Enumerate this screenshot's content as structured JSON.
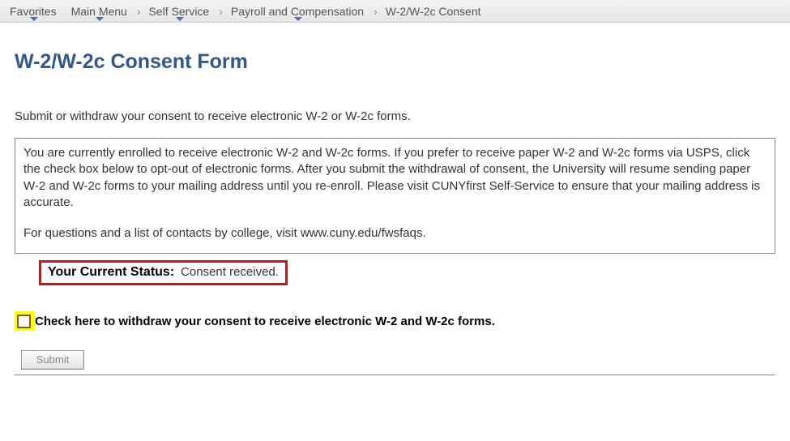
{
  "nav": {
    "favorites": "Favorites",
    "main_menu": "Main Menu",
    "self_service": "Self Service",
    "payroll": "Payroll and Compensation",
    "current": "W-2/W-2c Consent"
  },
  "page": {
    "title": "W-2/W-2c Consent Form",
    "instruction": "Submit or withdraw your consent to receive electronic W-2 or W-2c forms.",
    "info_p1": "You are currently enrolled to receive electronic W-2 and W-2c forms.  If you prefer to receive paper W-2 and W-2c forms via USPS, click the check box below to opt-out of electronic forms.  After you submit the withdrawal of consent, the University will resume sending paper W-2 and W-2c forms to your mailing address until you re-enroll.  Please visit CUNYfirst Self-Service to ensure that your mailing address is accurate.",
    "info_p2": "For questions and a list of contacts by college, visit www.cuny.edu/fwsfaqs.",
    "status_label": "Your Current Status:",
    "status_value": "Consent received.",
    "checkbox_label": "Check here to withdraw your consent to receive electronic W-2 and W-2c forms.",
    "submit_label": "Submit"
  }
}
